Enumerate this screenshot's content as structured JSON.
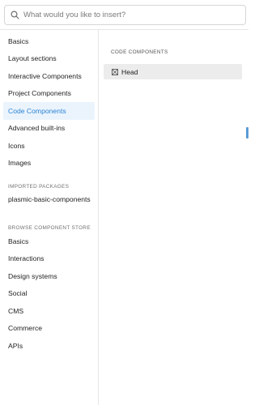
{
  "search": {
    "placeholder": "What would you like to insert?"
  },
  "sidebar": {
    "items": [
      {
        "label": "Basics",
        "active": false
      },
      {
        "label": "Layout sections",
        "active": false
      },
      {
        "label": "Interactive Components",
        "active": false
      },
      {
        "label": "Project Components",
        "active": false
      },
      {
        "label": "Code Components",
        "active": true
      },
      {
        "label": "Advanced built-ins",
        "active": false
      },
      {
        "label": "Icons",
        "active": false
      },
      {
        "label": "Images",
        "active": false
      }
    ],
    "imported_header": "IMPORTED PACKAGES",
    "imported_items": [
      {
        "label": "plasmic-basic-components"
      }
    ],
    "store_header": "BROWSE COMPONENT STORE",
    "store_items": [
      {
        "label": "Basics"
      },
      {
        "label": "Interactions"
      },
      {
        "label": "Design systems"
      },
      {
        "label": "Social"
      },
      {
        "label": "CMS"
      },
      {
        "label": "Commerce"
      },
      {
        "label": "APIs"
      }
    ]
  },
  "main": {
    "section_title": "CODE COMPONENTS",
    "components": [
      {
        "label": "Head",
        "icon": "component-box-icon"
      }
    ]
  },
  "colors": {
    "accent": "#2c83d4",
    "active_bg": "#ebf4fd",
    "item_bg": "#ececec"
  }
}
